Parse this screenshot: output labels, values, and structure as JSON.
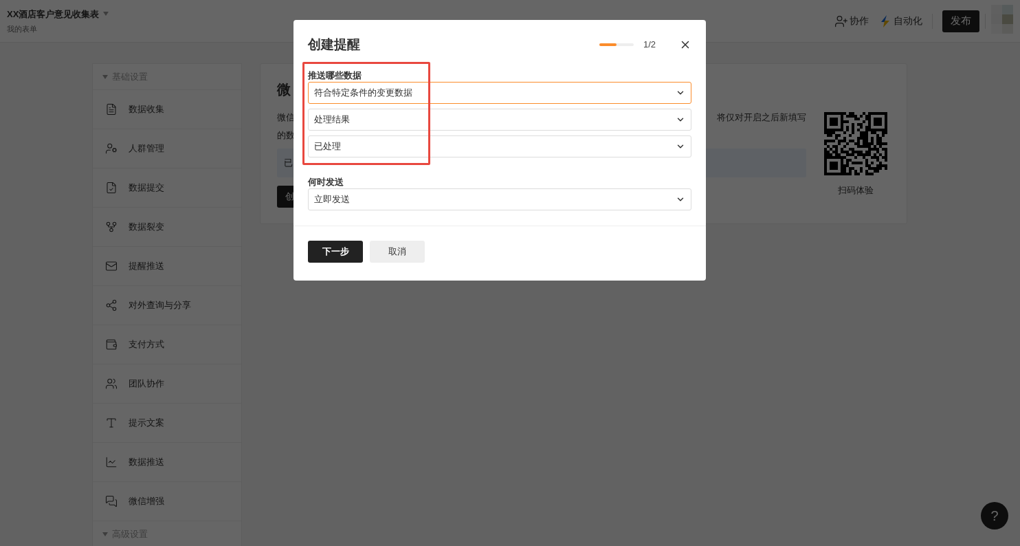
{
  "header": {
    "title": "XX酒店客户意见收集表",
    "subtitle": "我的表单",
    "actions": [
      "协作",
      "自动化"
    ],
    "publish": "发布"
  },
  "sidebar": {
    "sections": [
      {
        "title": "基础设置",
        "expanded": true,
        "items": [
          "数据收集",
          "人群管理",
          "数据提交",
          "数据裂变",
          "提醒推送",
          "对外查询与分享",
          "支付方式",
          "团队协作",
          "提示文案",
          "数据推送",
          "微信增强"
        ]
      },
      {
        "title": "高级设置",
        "expanded": true
      }
    ]
  },
  "card": {
    "title": "微",
    "line_1_left": "微信",
    "line_1_right": "将仅对开启之后新填写",
    "line_2": "的数",
    "notice": "已",
    "button": "创",
    "qr_label": "扫码体验"
  },
  "dialog": {
    "title": "创建提醒",
    "progress": {
      "level": 0.5,
      "reading": "1/2"
    },
    "fields": [
      {
        "label": "推送哪些数据",
        "selects": [
          {
            "value": "符合特定条件的变更数据",
            "focused": true
          },
          {
            "value": "处理结果",
            "focused": false
          },
          {
            "value": "已处理",
            "focused": false
          }
        ],
        "highlighted": true
      },
      {
        "label": "何时发送",
        "selects": [
          {
            "value": "立即发送",
            "focused": false
          }
        ],
        "highlighted": false
      }
    ],
    "primary": "下一步",
    "secondary": "取消"
  },
  "help": "?"
}
